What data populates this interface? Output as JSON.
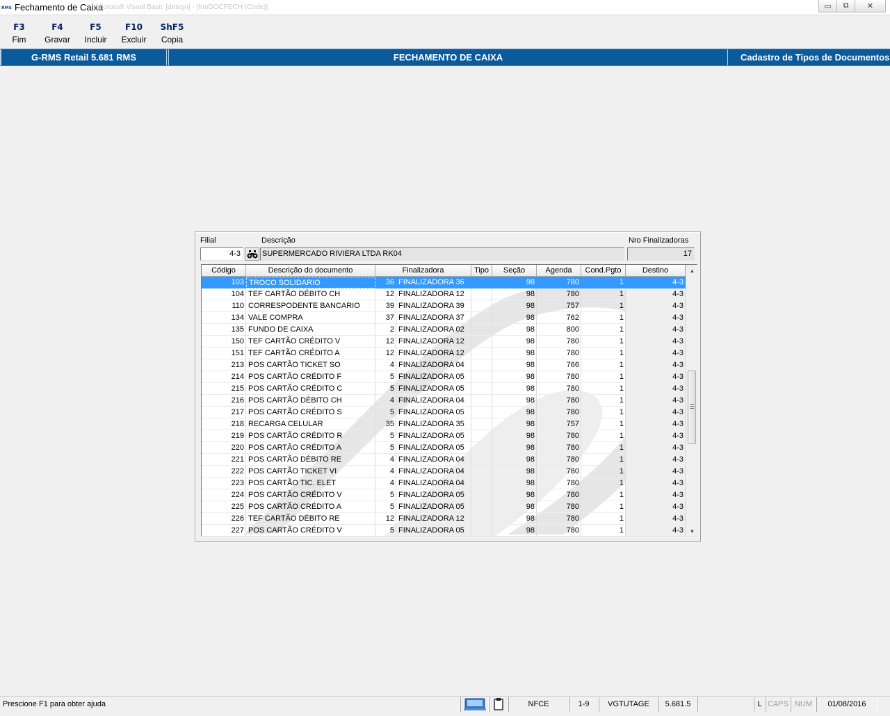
{
  "window": {
    "app_icon_text": "RMS",
    "title": "Fechamento de Caixa",
    "ghost_text": "Microsoft Visual Basic [design] - [frmDOCFECH (Code)]",
    "minimize_glyph": "▭",
    "restore_glyph": "⧉",
    "close_glyph": "✕"
  },
  "toolbar": {
    "keys": [
      {
        "key": "F3",
        "label": "Fim"
      },
      {
        "key": "F4",
        "label": "Gravar"
      },
      {
        "key": "F5",
        "label": "Incluir"
      },
      {
        "key": "F10",
        "label": "Excluir"
      },
      {
        "key": "ShF5",
        "label": "Copia"
      }
    ]
  },
  "header": {
    "product": "G-RMS Retail 5.681 RMS",
    "screen": "FECHAMENTO DE CAIXA",
    "context": "Cadastro de Tipos de Documentos"
  },
  "form": {
    "filial_label": "Filial",
    "filial_value": "4-3",
    "descricao_label": "Descrição",
    "descricao_value": "SUPERMERCADO RIVIERA LTDA RK04",
    "nro_label": "Nro Finalizadoras",
    "nro_value": "17"
  },
  "grid": {
    "columns": [
      "Código",
      "Descrição do documento",
      "Finalizadora",
      "Tipo",
      "Seção",
      "Agenda",
      "Cond.Pgto",
      "Destino"
    ],
    "selected_row": 0,
    "rows": [
      {
        "codigo": "103",
        "descricao": "TROCO SOLIDARIO",
        "fin_num": "36",
        "fin_nome": "FINALIZADORA 36",
        "tipo": "",
        "secao": "98",
        "agenda": "780",
        "cond": "1",
        "destino": "4-3"
      },
      {
        "codigo": "104",
        "descricao": "TEF CARTÃO DÉBITO CH",
        "fin_num": "12",
        "fin_nome": "FINALIZADORA 12",
        "tipo": "",
        "secao": "98",
        "agenda": "780",
        "cond": "1",
        "destino": "4-3"
      },
      {
        "codigo": "110",
        "descricao": "CORRESPODENTE BANCARIO",
        "fin_num": "39",
        "fin_nome": "FINALIZADORA 39",
        "tipo": "",
        "secao": "98",
        "agenda": "757",
        "cond": "1",
        "destino": "4-3"
      },
      {
        "codigo": "134",
        "descricao": "VALE COMPRA",
        "fin_num": "37",
        "fin_nome": "FINALIZADORA 37",
        "tipo": "",
        "secao": "98",
        "agenda": "762",
        "cond": "1",
        "destino": "4-3"
      },
      {
        "codigo": "135",
        "descricao": "FUNDO DE CAIXA",
        "fin_num": "2",
        "fin_nome": "FINALIZADORA 02",
        "tipo": "",
        "secao": "98",
        "agenda": "800",
        "cond": "1",
        "destino": "4-3"
      },
      {
        "codigo": "150",
        "descricao": "TEF CARTÃO CRÉDITO V",
        "fin_num": "12",
        "fin_nome": "FINALIZADORA 12",
        "tipo": "",
        "secao": "98",
        "agenda": "780",
        "cond": "1",
        "destino": "4-3"
      },
      {
        "codigo": "151",
        "descricao": "TEF CARTÃO CRÉDITO A",
        "fin_num": "12",
        "fin_nome": "FINALIZADORA 12",
        "tipo": "",
        "secao": "98",
        "agenda": "780",
        "cond": "1",
        "destino": "4-3"
      },
      {
        "codigo": "213",
        "descricao": "POS CARTÃO TICKET SO",
        "fin_num": "4",
        "fin_nome": "FINALIZADORA 04",
        "tipo": "",
        "secao": "98",
        "agenda": "766",
        "cond": "1",
        "destino": "4-3"
      },
      {
        "codigo": "214",
        "descricao": "POS CARTÃO CRÉDITO F",
        "fin_num": "5",
        "fin_nome": "FINALIZADORA 05",
        "tipo": "",
        "secao": "98",
        "agenda": "780",
        "cond": "1",
        "destino": "4-3"
      },
      {
        "codigo": "215",
        "descricao": "POS CARTÃO CRÉDITO C",
        "fin_num": "5",
        "fin_nome": "FINALIZADORA 05",
        "tipo": "",
        "secao": "98",
        "agenda": "780",
        "cond": "1",
        "destino": "4-3"
      },
      {
        "codigo": "216",
        "descricao": "POS CARTÃO DÉBITO CH",
        "fin_num": "4",
        "fin_nome": "FINALIZADORA 04",
        "tipo": "",
        "secao": "98",
        "agenda": "780",
        "cond": "1",
        "destino": "4-3"
      },
      {
        "codigo": "217",
        "descricao": "POS CARTÃO CRÉDITO S",
        "fin_num": "5",
        "fin_nome": "FINALIZADORA 05",
        "tipo": "",
        "secao": "98",
        "agenda": "780",
        "cond": "1",
        "destino": "4-3"
      },
      {
        "codigo": "218",
        "descricao": "RECARGA CELULAR",
        "fin_num": "35",
        "fin_nome": "FINALIZADORA 35",
        "tipo": "",
        "secao": "98",
        "agenda": "757",
        "cond": "1",
        "destino": "4-3"
      },
      {
        "codigo": "219",
        "descricao": "POS CARTÃO CRÉDITO R",
        "fin_num": "5",
        "fin_nome": "FINALIZADORA 05",
        "tipo": "",
        "secao": "98",
        "agenda": "780",
        "cond": "1",
        "destino": "4-3"
      },
      {
        "codigo": "220",
        "descricao": "POS CARTÃO CRÉDITO A",
        "fin_num": "5",
        "fin_nome": "FINALIZADORA 05",
        "tipo": "",
        "secao": "98",
        "agenda": "780",
        "cond": "1",
        "destino": "4-3"
      },
      {
        "codigo": "221",
        "descricao": "POS CARTÃO DÉBITO RE",
        "fin_num": "4",
        "fin_nome": "FINALIZADORA 04",
        "tipo": "",
        "secao": "98",
        "agenda": "780",
        "cond": "1",
        "destino": "4-3"
      },
      {
        "codigo": "222",
        "descricao": "POS CARTÃO TICKET VI",
        "fin_num": "4",
        "fin_nome": "FINALIZADORA 04",
        "tipo": "",
        "secao": "98",
        "agenda": "780",
        "cond": "1",
        "destino": "4-3"
      },
      {
        "codigo": "223",
        "descricao": "POS CARTÃO TIC. ELET",
        "fin_num": "4",
        "fin_nome": "FINALIZADORA 04",
        "tipo": "",
        "secao": "98",
        "agenda": "780",
        "cond": "1",
        "destino": "4-3"
      },
      {
        "codigo": "224",
        "descricao": "POS CARTÃO CRÉDITO V",
        "fin_num": "5",
        "fin_nome": "FINALIZADORA 05",
        "tipo": "",
        "secao": "98",
        "agenda": "780",
        "cond": "1",
        "destino": "4-3"
      },
      {
        "codigo": "225",
        "descricao": "POS CARTÃO CRÉDITO A",
        "fin_num": "5",
        "fin_nome": "FINALIZADORA 05",
        "tipo": "",
        "secao": "98",
        "agenda": "780",
        "cond": "1",
        "destino": "4-3"
      },
      {
        "codigo": "226",
        "descricao": "TEF CARTÃO DÉBITO RE",
        "fin_num": "12",
        "fin_nome": "FINALIZADORA 12",
        "tipo": "",
        "secao": "98",
        "agenda": "780",
        "cond": "1",
        "destino": "4-3"
      },
      {
        "codigo": "227",
        "descricao": "POS CARTÃO CRÉDITO V",
        "fin_num": "5",
        "fin_nome": "FINALIZADORA 05",
        "tipo": "",
        "secao": "98",
        "agenda": "780",
        "cond": "1",
        "destino": "4-3"
      }
    ],
    "scroll_up_glyph": "▲",
    "scroll_down_glyph": "▼"
  },
  "statusbar": {
    "help": "Prescione F1 para obter ajuda",
    "mode": "NFCE",
    "range": "1-9",
    "user": "VGTUTAGE",
    "version": "5.681.5",
    "blank": "",
    "l_indicator": "L",
    "caps": "CAPS",
    "num": "NUM",
    "date": "01/08/2016"
  },
  "icons": {
    "binoculars": "binoculars-icon",
    "network": "network-computer-icon",
    "clipboard": "clipboard-icon"
  },
  "colors": {
    "header_blue": "#0a5a9c",
    "selection_blue": "#3399ff",
    "key_navy": "#00215c"
  }
}
